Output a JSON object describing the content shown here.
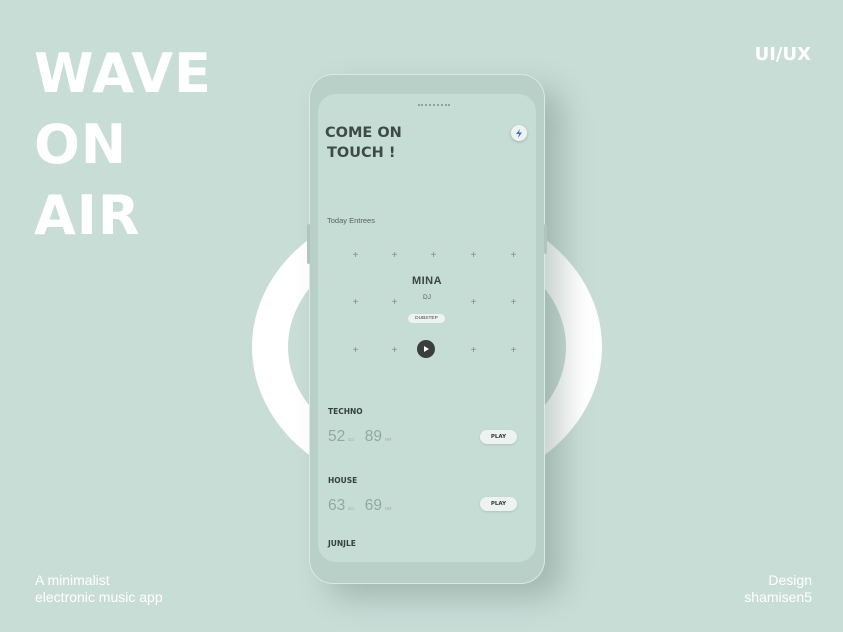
{
  "hero": {
    "line1": "WAVE",
    "line2": "ON",
    "line3": "AIR"
  },
  "tag": "UI/UX",
  "subtitle": {
    "line1": "A minimalist",
    "line2": "electronic music app"
  },
  "credit": {
    "line1": "Design",
    "line2": "shamisen5"
  },
  "app": {
    "title_line1": "COME ON",
    "title_line2": "TOUCH !",
    "entrees_label": "Today Entrees",
    "artist": {
      "name": "MINA",
      "role": "DJ",
      "genre": "DUBSTEP"
    },
    "genres": [
      {
        "name": "TECHNO",
        "dj_count": "52",
        "dj_unit": "DJ",
        "hr_count": "89",
        "hr_unit": "HR",
        "play_label": "PLAY"
      },
      {
        "name": "HOUSE",
        "dj_count": "63",
        "dj_unit": "DJ",
        "hr_count": "69",
        "hr_unit": "HR",
        "play_label": "PLAY"
      },
      {
        "name": "JUNJLE"
      }
    ]
  },
  "icons": {
    "bolt": "lightning-icon",
    "play": "play-icon",
    "grid": "plus-icon"
  },
  "colors": {
    "background": "#c9ddd7",
    "screen": "#c6ddd6",
    "text_dark": "#3f4a47",
    "stat": "#8fa9a1",
    "white": "#ffffff"
  }
}
